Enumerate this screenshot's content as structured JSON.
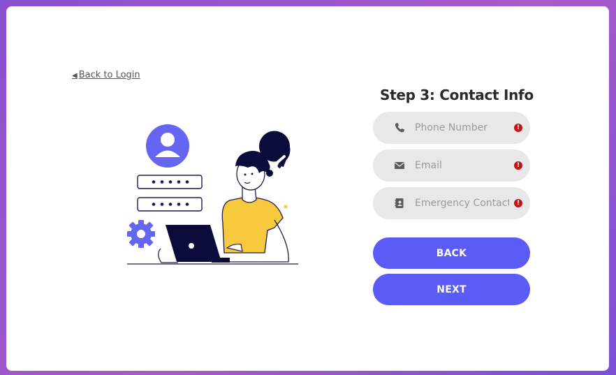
{
  "nav": {
    "back_arrow": "◀",
    "back_label": "Back to Login"
  },
  "form": {
    "title": "Step 3: Contact Info",
    "fields": [
      {
        "icon": "phone-icon",
        "placeholder": "Phone Number",
        "value": "",
        "error": "!"
      },
      {
        "icon": "envelope-icon",
        "placeholder": "Email",
        "value": "",
        "error": "!"
      },
      {
        "icon": "contact-book-icon",
        "placeholder": "Emergency Contact",
        "value": "",
        "error": "!"
      }
    ],
    "buttons": {
      "back": "BACK",
      "next": "NEXT"
    }
  },
  "illustration": {
    "icons": [
      "user-avatar-icon",
      "password-field-icon",
      "gear-icon",
      "checkmark-bubble-icon",
      "laptop-icon",
      "person-icon"
    ]
  },
  "colors": {
    "accent": "#5b5bf5",
    "error": "#c81313",
    "field_bg": "#e8e8e8",
    "shirt": "#f7c93c",
    "dark": "#0b0b3b"
  }
}
